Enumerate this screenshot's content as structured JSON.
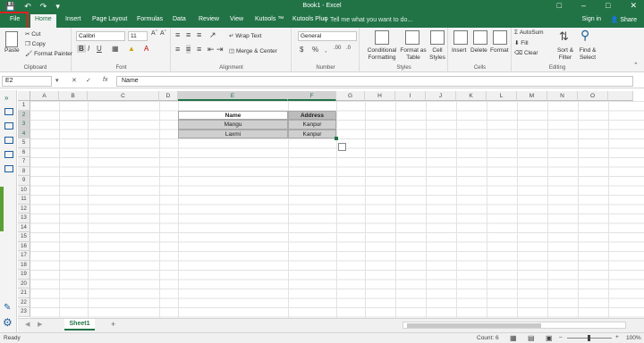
{
  "window": {
    "title": "Book1 - Excel",
    "save_icon": "save-icon",
    "undo_icon": "undo-icon",
    "redo_icon": "redo-icon"
  },
  "tabs": [
    {
      "label": "File"
    },
    {
      "label": "Home"
    },
    {
      "label": "Insert"
    },
    {
      "label": "Page Layout"
    },
    {
      "label": "Formulas"
    },
    {
      "label": "Data"
    },
    {
      "label": "Review"
    },
    {
      "label": "View"
    },
    {
      "label": "Kutools ™"
    },
    {
      "label": "Kutools Plus"
    }
  ],
  "tell_me": "Tell me what you want to do...",
  "sign_in": "Sign in",
  "share": "Share",
  "ribbon": {
    "clipboard": {
      "label": "Clipboard",
      "paste": "Paste",
      "cut": "Cut",
      "copy": "Copy",
      "format_painter": "Format Painter"
    },
    "font": {
      "label": "Font",
      "name": "Calibri",
      "size": "11"
    },
    "alignment": {
      "label": "Alignment",
      "wrap": "Wrap Text",
      "merge": "Merge & Center"
    },
    "number": {
      "label": "Number",
      "format": "General"
    },
    "styles": {
      "label": "Styles",
      "conditional": "Conditional Formatting",
      "format_table": "Format as Table",
      "cell_styles": "Cell Styles"
    },
    "cells": {
      "label": "Cells",
      "insert": "Insert",
      "delete": "Delete",
      "format": "Format"
    },
    "editing": {
      "label": "Editing",
      "autosum": "AutoSum",
      "fill": "Fill",
      "clear": "Clear",
      "sort": "Sort & Filter",
      "find": "Find & Select"
    }
  },
  "formula_bar": {
    "name_box": "E2",
    "fx": "fx",
    "content": "Name"
  },
  "columns": [
    "A",
    "B",
    "C",
    "D",
    "E",
    "F",
    "G",
    "H",
    "I",
    "J",
    "K",
    "L",
    "M",
    "N",
    "O"
  ],
  "rows": [
    "1",
    "2",
    "3",
    "4",
    "5",
    "6",
    "7",
    "8",
    "9",
    "10",
    "11",
    "12",
    "13",
    "14",
    "15",
    "16",
    "17",
    "18",
    "19",
    "20",
    "21",
    "22",
    "23"
  ],
  "table": {
    "headers": [
      "Name",
      "Address"
    ],
    "rows": [
      [
        "Mangu",
        "Kanpur"
      ],
      [
        "Laxmi",
        "Kanpur"
      ]
    ]
  },
  "sheet": {
    "tab": "Sheet1",
    "add": "+"
  },
  "status": {
    "ready": "Ready",
    "count": "Count: 6",
    "zoom": "100%"
  }
}
